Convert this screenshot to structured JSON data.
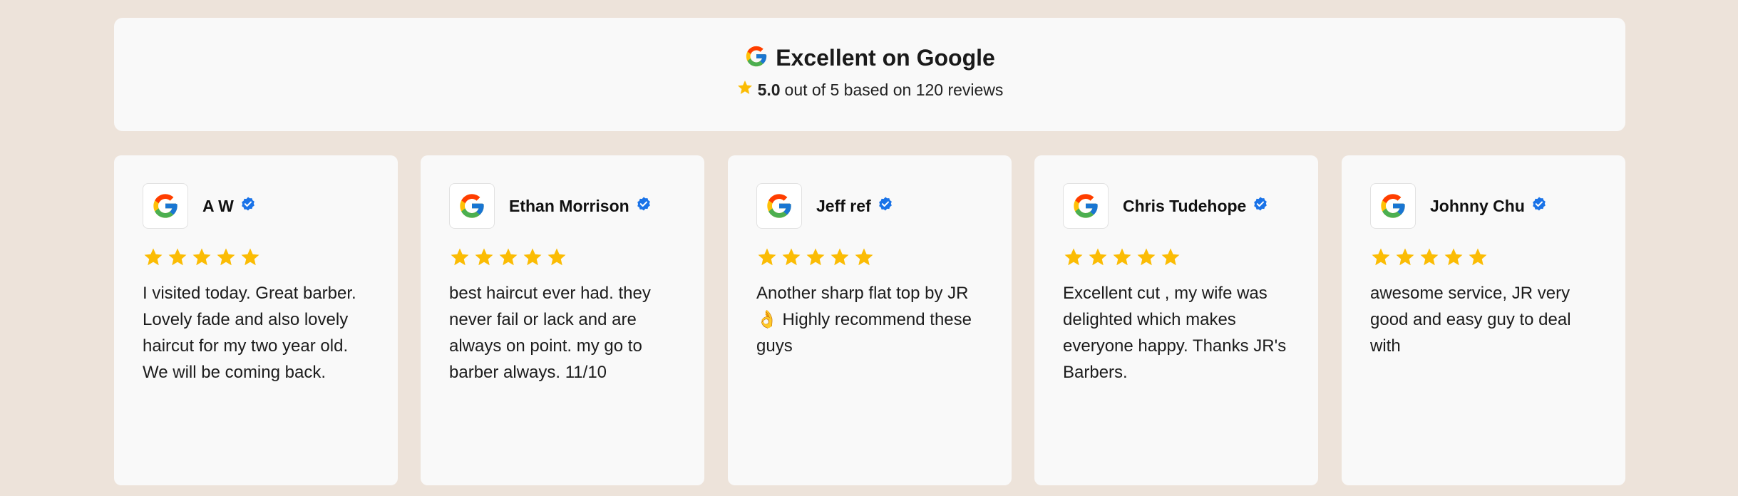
{
  "summary": {
    "title": "Excellent on Google",
    "score": "5.0",
    "rating_text": "out of 5 based on 120 reviews"
  },
  "reviews": [
    {
      "name": "A W",
      "stars": 5,
      "text": "I visited today. Great barber. Lovely fade and also lovely haircut for my two year old. We will be coming back."
    },
    {
      "name": "Ethan Morrison",
      "stars": 5,
      "text": "best haircut ever had. they never fail or lack and are always on point. my go to barber always. 11/10"
    },
    {
      "name": "Jeff ref",
      "stars": 5,
      "text": "Another sharp flat top by JR 👌 Highly recommend these guys"
    },
    {
      "name": "Chris Tudehope",
      "stars": 5,
      "text": "Excellent cut , my wife was delighted which makes everyone happy. Thanks JR's Barbers."
    },
    {
      "name": "Johnny Chu",
      "stars": 5,
      "text": "awesome service, JR very good and easy guy to deal with"
    }
  ],
  "icons": {
    "google": "google-g-icon",
    "verified": "verified-badge-icon",
    "star": "star-icon"
  },
  "colors": {
    "background": "#ede3da",
    "card": "#f9f9f9",
    "star": "#fbbc04",
    "verified": "#1a73e8"
  }
}
